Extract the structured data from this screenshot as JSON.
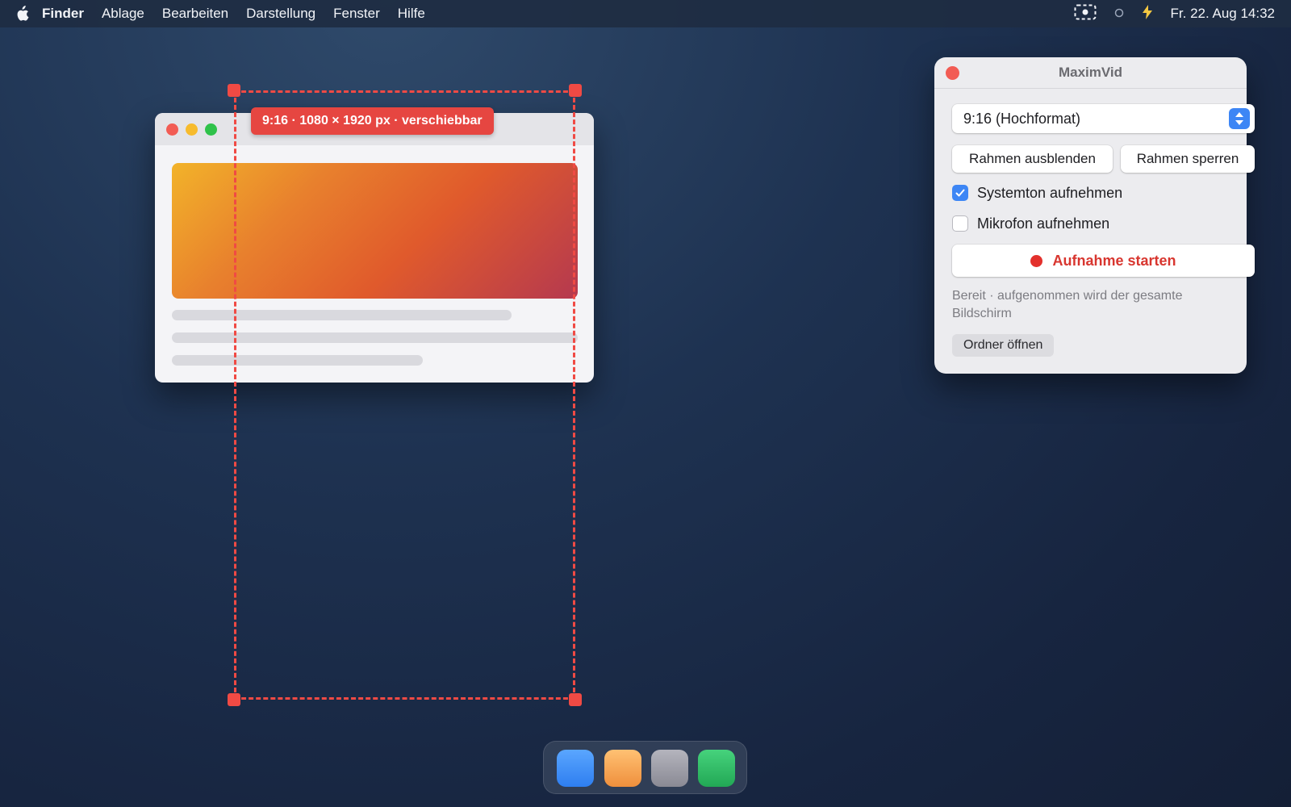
{
  "menubar": {
    "app_name": "Finder",
    "menus": [
      "Ablage",
      "Bearbeiten",
      "Darstellung",
      "Fenster",
      "Hilfe"
    ],
    "status_icons": [
      "screen-record-icon",
      "circle-icon",
      "bolt-icon"
    ],
    "clock": "Fr. 22. Aug  14:32"
  },
  "capture_frame": {
    "label": "9:16 · 1080 × 1920 px · verschiebbar",
    "color": "#f04a44"
  },
  "panel": {
    "title": "MaximVid",
    "aspect_select": {
      "value": "9:16 (Hochformat)"
    },
    "hide_frame_label": "Rahmen ausblenden",
    "lock_frame_label": "Rahmen sperren",
    "system_audio": {
      "label": "Systemton aufnehmen",
      "checked": true
    },
    "microphone": {
      "label": "Mikrofon aufnehmen",
      "checked": false
    },
    "record_label": "Aufnahme starten",
    "status": "Bereit · aufgenommen wird der gesamte Bildschirm",
    "open_folder_label": "Ordner öffnen",
    "accent_color": "#3d86f5",
    "record_color": "#d8362f"
  },
  "dock": {
    "icons": [
      {
        "name": "blue-app-icon",
        "color": "#3a8ef6"
      },
      {
        "name": "orange-app-icon",
        "color": "#f2a14a"
      },
      {
        "name": "gray-app-icon",
        "color": "#9d9da6"
      },
      {
        "name": "green-app-icon",
        "color": "#2fbf63"
      }
    ]
  }
}
